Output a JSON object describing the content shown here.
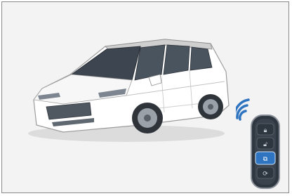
{
  "scene": {
    "subject": "car-illustration",
    "accessory": "key-fob",
    "signal": "wireless-waves"
  },
  "colors": {
    "background": "#f3f3f3",
    "border": "#8a8a8a",
    "signal": "#2f74c0",
    "remote_body": "#2e3640",
    "remote_highlight": "#2f74c0"
  },
  "key_fob": {
    "buttons": [
      {
        "icon": "lock-icon",
        "active": false
      },
      {
        "icon": "unlock-icon",
        "active": false
      },
      {
        "icon": "trunk-icon",
        "active": true
      },
      {
        "icon": "remote-start-icon",
        "active": false
      }
    ]
  }
}
